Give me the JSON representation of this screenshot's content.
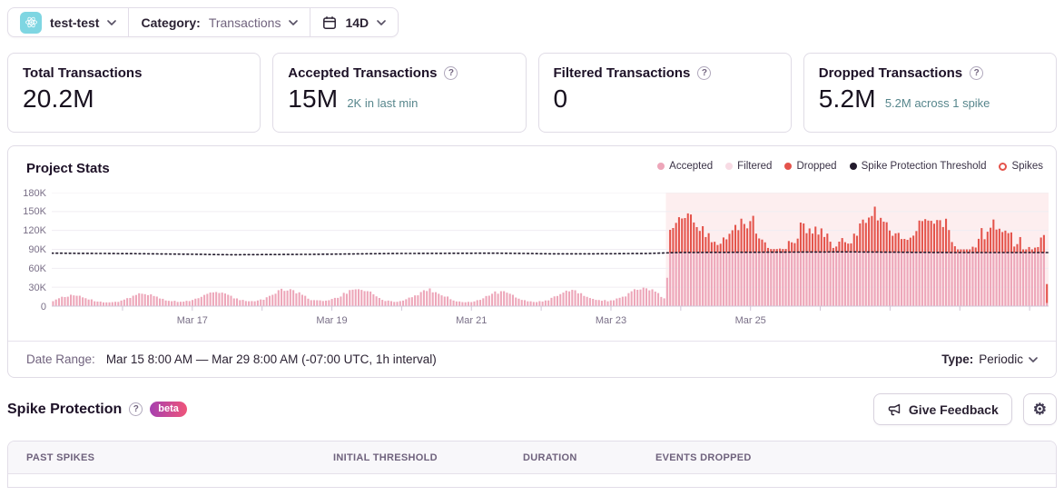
{
  "topbar": {
    "project": {
      "name": "test-test",
      "platform": "react"
    },
    "category": {
      "label": "Category:",
      "value": "Transactions"
    },
    "period": {
      "value": "14D"
    }
  },
  "stat_cards": [
    {
      "title": "Total Transactions",
      "value": "20.2M",
      "subtext": "",
      "has_help": false
    },
    {
      "title": "Accepted Transactions",
      "value": "15M",
      "subtext": "2K in last min",
      "has_help": true
    },
    {
      "title": "Filtered Transactions",
      "value": "0",
      "subtext": "",
      "has_help": true
    },
    {
      "title": "Dropped Transactions",
      "value": "5.2M",
      "subtext": "5.2M across 1 spike",
      "has_help": true
    }
  ],
  "project_stats": {
    "title": "Project Stats",
    "legend": [
      {
        "label": "Accepted",
        "color": "#eda6b9",
        "marker": "dot"
      },
      {
        "label": "Filtered",
        "color": "#f8dbe4",
        "marker": "dot"
      },
      {
        "label": "Dropped",
        "color": "#e4534b",
        "marker": "dot"
      },
      {
        "label": "Spike Protection Threshold",
        "color": "#221a2c",
        "marker": "dot"
      },
      {
        "label": "Spikes",
        "color": "#e4534b",
        "marker": "ring"
      }
    ],
    "footer": {
      "date_range_label": "Date Range:",
      "date_range_value": "Mar 15 8:00 AM — Mar 29 8:00 AM (-07:00 UTC, 1h interval)",
      "type_label": "Type:",
      "type_value": "Periodic"
    }
  },
  "chart_data": {
    "type": "bar",
    "stacked": true,
    "x_start": "Mar 15 8:00 AM",
    "x_end": "Mar 29 8:00 AM",
    "interval": "1h",
    "n_bars": 336,
    "ylim_k": [
      0,
      180
    ],
    "yticks": [
      "180K",
      "150K",
      "120K",
      "90K",
      "60K",
      "30K",
      "0"
    ],
    "xtick_labels": [
      "Mar 17",
      "Mar 19",
      "Mar 21",
      "Mar 23",
      "Mar 25"
    ],
    "xtick_fractions": [
      0.141,
      0.281,
      0.421,
      0.561,
      0.701
    ],
    "day_tick_fractions": [
      0.071,
      0.141,
      0.211,
      0.281,
      0.351,
      0.421,
      0.491,
      0.561,
      0.631,
      0.701,
      0.771,
      0.841,
      0.911,
      0.981
    ],
    "series": [
      {
        "name": "Accepted",
        "color": "#eda6b9",
        "baseline_hourly_profile_k": [
          10,
          9,
          8.5,
          8,
          8.5,
          9,
          10.5,
          12,
          14,
          16.5,
          19,
          21.5,
          24,
          26,
          27.5,
          28,
          27,
          25.5,
          23.5,
          21,
          18,
          15.5,
          13,
          11
        ],
        "day_multipliers": [
          0.62,
          0.72,
          0.85,
          0.95,
          1.0,
          0.9,
          0.8,
          0.85,
          1.05,
          0.95,
          0.9,
          1.0,
          1.0,
          1.0
        ],
        "behavior_during_spike": "capped at spike protection threshold (~85K)"
      },
      {
        "name": "Filtered",
        "color": "#f8dbe4",
        "values": "all zero"
      },
      {
        "name": "Dropped",
        "color": "#e4534b",
        "pre_spike": 0,
        "spike_extra_k_range": [
          5,
          76
        ],
        "spike_total_k_range": [
          95,
          162
        ]
      }
    ],
    "threshold_points": [
      [
        0,
        84
      ],
      [
        0.1,
        83
      ],
      [
        0.18,
        81.5
      ],
      [
        0.25,
        82
      ],
      [
        0.35,
        83.5
      ],
      [
        0.45,
        84
      ],
      [
        0.5,
        83
      ],
      [
        0.55,
        83
      ],
      [
        0.6,
        83.5
      ],
      [
        0.63,
        85
      ],
      [
        0.72,
        85.5
      ],
      [
        0.8,
        86
      ],
      [
        0.9,
        85
      ],
      [
        1,
        85
      ]
    ],
    "spike_region": {
      "start_hour_index": 207,
      "end_hour_index": 336,
      "start_fraction": 0.617,
      "fill": "rgba(234,70,78,0.09)"
    },
    "summary": {
      "total": "20.2M",
      "accepted": "15M",
      "filtered": "0",
      "dropped": "5.2M",
      "spike_count": 1
    }
  },
  "spike_protection": {
    "title": "Spike Protection",
    "beta_label": "beta",
    "give_feedback_label": "Give Feedback"
  },
  "spike_table": {
    "columns": [
      "Past Spikes",
      "Initial Threshold",
      "Duration",
      "Events Dropped"
    ]
  }
}
